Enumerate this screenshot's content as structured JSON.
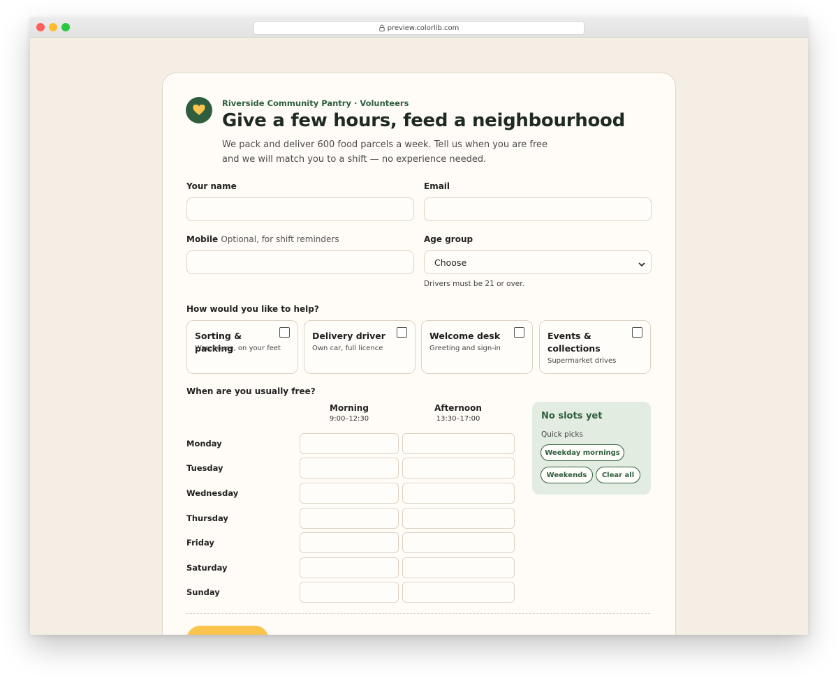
{
  "browser": {
    "url": "preview.colorlib.com"
  },
  "header": {
    "eyebrow": "Riverside Community Pantry · Volunteers",
    "title": "Give a few hours, feed a neighbourhood",
    "subtitle": "We pack and deliver 600 food parcels a week. Tell us when you are free and we will match you to a shift — no experience needed."
  },
  "form": {
    "name_label": "Your name",
    "name_value": "",
    "email_label": "Email",
    "email_value": "",
    "mobile_label": "Mobile",
    "mobile_optional": "Optional, for shift reminders",
    "mobile_value": "",
    "age_label": "Age group",
    "age_selected": "Choose",
    "age_hint": "Drivers must be 21 or over."
  },
  "help": {
    "question": "How would you like to help?",
    "options": [
      {
        "title": "Sorting & packing",
        "sub": "Warehouse, on your feet",
        "checked": false
      },
      {
        "title": "Delivery driver",
        "sub": "Own car, full licence",
        "checked": false
      },
      {
        "title": "Welcome desk",
        "sub": "Greeting and sign-in",
        "checked": false
      },
      {
        "title": "Events & collections",
        "sub": "Supermarket drives",
        "checked": false
      }
    ]
  },
  "availability": {
    "question": "When are you usually free?",
    "columns": [
      {
        "name": "Morning",
        "time": "9:00–12:30"
      },
      {
        "name": "Afternoon",
        "time": "13:30–17:00"
      }
    ],
    "days": [
      "Monday",
      "Tuesday",
      "Wednesday",
      "Thursday",
      "Friday",
      "Saturday",
      "Sunday"
    ]
  },
  "summary": {
    "title": "No slots yet",
    "quick_label": "Quick picks",
    "picks": [
      "Weekday mornings",
      "Weekends",
      "Clear all"
    ]
  },
  "colors": {
    "brand_green": "#2e5e3e",
    "accent_yellow": "#fbc44f",
    "page_bg": "#f5eee4"
  }
}
